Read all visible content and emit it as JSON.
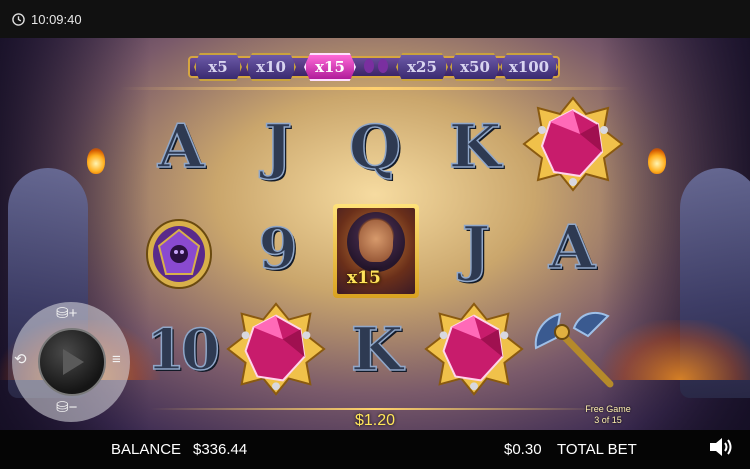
{
  "status_bar": {
    "time": "10:09:40"
  },
  "multipliers": {
    "labels": [
      "x5",
      "x10",
      "x15",
      "x25",
      "x50",
      "x100"
    ],
    "active": "x15"
  },
  "reels": {
    "row1": [
      "A",
      "J",
      "Q",
      "K",
      "gem-icon"
    ],
    "row2": [
      "shield-icon",
      "9",
      "wild",
      "J",
      "A"
    ],
    "row3": [
      "10",
      "gem-icon",
      "K",
      "gem-icon",
      "axe-icon"
    ],
    "wild_multiplier": "x15"
  },
  "win": {
    "amount": "$1.20"
  },
  "free_game": {
    "title": "Free Game",
    "progress": "3 of 15"
  },
  "bottom_bar": {
    "balance_label": "BALANCE",
    "balance_value": "$336.44",
    "bet_value": "$0.30",
    "total_bet_label": "TOTAL BET"
  },
  "colors": {
    "accent_gold": "#d6a640",
    "active_multiplier": "#ff40c8",
    "gem": "#e0267a",
    "win_text": "#ffe65a"
  }
}
